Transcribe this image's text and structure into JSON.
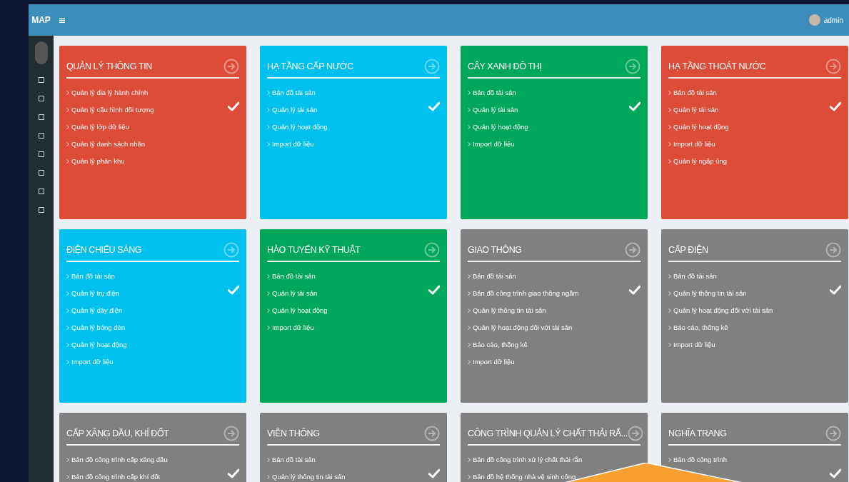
{
  "header": {
    "logo": "MAP",
    "user": "admin"
  },
  "cards": [
    {
      "title": "QUẢN LÝ THÔNG TIN",
      "color": "#dd4b39",
      "checked": true,
      "items": [
        "Quản lý địa lý hành chính",
        "Quản lý cấu hình đối tượng",
        "Quản lý lớp dữ liệu",
        "Quản lý danh sách nhãn",
        "Quản lý phân khu"
      ]
    },
    {
      "title": "HẠ TẦNG CẤP NƯỚC",
      "color": "#00c0ef",
      "checked": true,
      "items": [
        "Bản đồ tài sản",
        "Quản lý tài sản",
        "Quản lý hoạt động",
        "Import dữ liệu"
      ]
    },
    {
      "title": "CÂY XANH ĐÔ THỊ",
      "color": "#00a65a",
      "checked": true,
      "items": [
        "Bản đồ tài sản",
        "Quản lý tài sản",
        "Quản lý hoạt động",
        "Import dữ liệu"
      ]
    },
    {
      "title": "HẠ TẦNG THOÁT NƯỚC",
      "color": "#dd4b39",
      "checked": true,
      "items": [
        "Bản đồ tài sản",
        "Quản lý tài sản",
        "Quản lý hoạt động",
        "Import dữ liệu",
        "Quản lý ngập úng"
      ]
    },
    {
      "title": "ĐIỆN CHIẾU SÁNG",
      "color": "#00c0ef",
      "checked": true,
      "items": [
        "Bản đồ tài sản",
        "Quản lý trụ điện",
        "Quản lý dây điện",
        "Quản lý bóng đèn",
        "Quản lý hoạt động",
        "Import dữ liệu"
      ]
    },
    {
      "title": "HÀO TUYẾN KỸ THUẬT",
      "color": "#00a65a",
      "checked": true,
      "items": [
        "Bản đồ tài sản",
        "Quản lý tài sản",
        "Quản lý hoạt động",
        "Import dữ liệu"
      ]
    },
    {
      "title": "GIAO THÔNG",
      "color": "#808080",
      "checked": true,
      "items": [
        "Bản đồ tài sản",
        "Bản đồ công trình giao thông ngầm",
        "Quản lý thông tin tài sản",
        "Quản lý hoạt động đối với tài sản",
        "Báo cáo, thống kê",
        "Import dữ liệu"
      ]
    },
    {
      "title": "CẤP ĐIỆN",
      "color": "#808080",
      "checked": true,
      "items": [
        "Bản đồ tài sản",
        "Quản lý thông tin tài sản",
        "Quản lý hoạt động đối với tài sản",
        "Báo cáo, thống kê",
        "Import dữ liệu"
      ]
    },
    {
      "title": "CẤP XĂNG DẦU, KHÍ ĐỐT",
      "color": "#808080",
      "checked": true,
      "items": [
        "Bản đồ công trình cấp xăng dầu",
        "Bản đồ công trình cấp khí đốt"
      ]
    },
    {
      "title": "VIỄN THÔNG",
      "color": "#808080",
      "checked": true,
      "items": [
        "Bản đồ tài sản",
        "Quản lý thông tin tài sản"
      ]
    },
    {
      "title": "CÔNG TRÌNH QUẢN LÝ CHẤT THẢI RẮ...",
      "color": "#808080",
      "checked": false,
      "items": [
        "Bản đồ công trình xử lý chất thải rắn",
        "Bản đồ hệ thống nhà vệ sinh công"
      ]
    },
    {
      "title": "NGHĨA TRANG",
      "color": "#808080",
      "checked": true,
      "items": [
        "Bản đồ công trình"
      ]
    }
  ]
}
